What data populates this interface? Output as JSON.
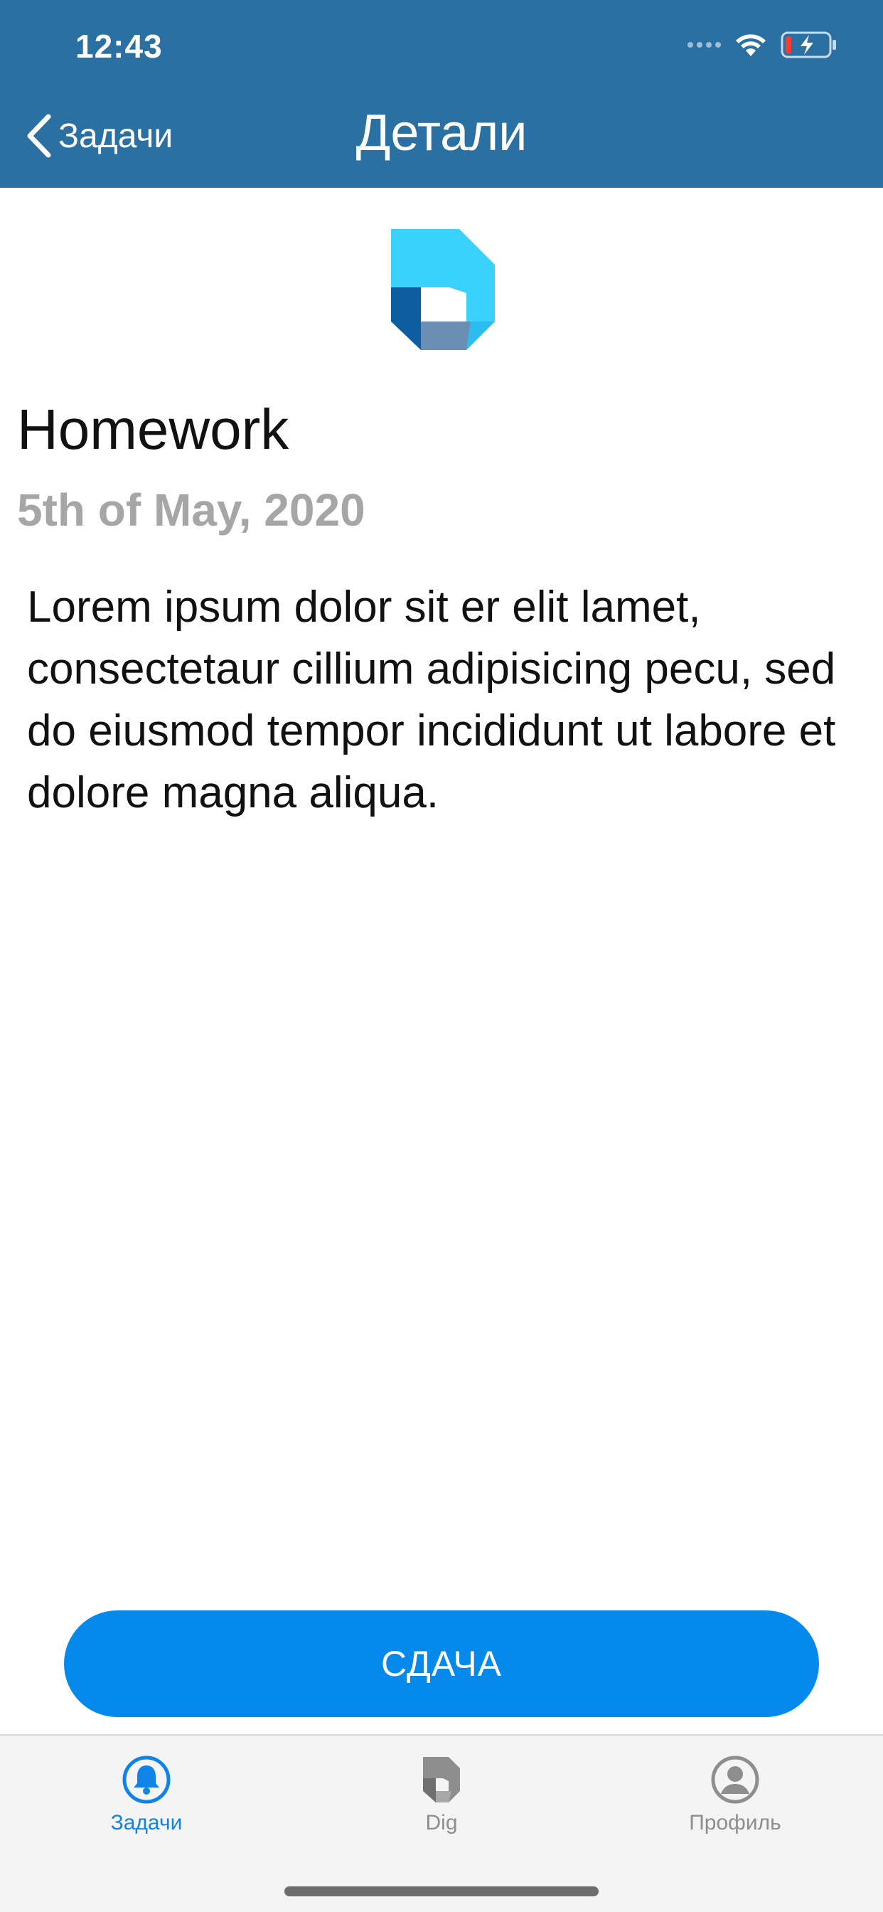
{
  "status_bar": {
    "time": "12:43",
    "icons": [
      "cellular-icon",
      "wifi-icon",
      "battery-charging-icon"
    ]
  },
  "nav": {
    "back_label": "Задачи",
    "title": "Детали"
  },
  "task": {
    "title": "Homework",
    "date": "5th of May, 2020",
    "description": "Lorem ipsum dolor sit er elit lamet, consectetaur cillium adipisicing pecu, sed do eiusmod tempor incididunt ut labore et dolore magna aliqua."
  },
  "submit_button": {
    "label": "СДАЧА"
  },
  "tabs": [
    {
      "label": "Задачи",
      "icon": "bell-icon",
      "active": true
    },
    {
      "label": "Dig",
      "icon": "dig-logo-icon",
      "active": false
    },
    {
      "label": "Профиль",
      "icon": "profile-icon",
      "active": false
    }
  ],
  "colors": {
    "header_bg": "#2a70a3",
    "accent": "#058aec",
    "tab_active": "#0f84e6",
    "tab_inactive": "#8e8e8e",
    "date_gray": "#a6a6a6"
  }
}
